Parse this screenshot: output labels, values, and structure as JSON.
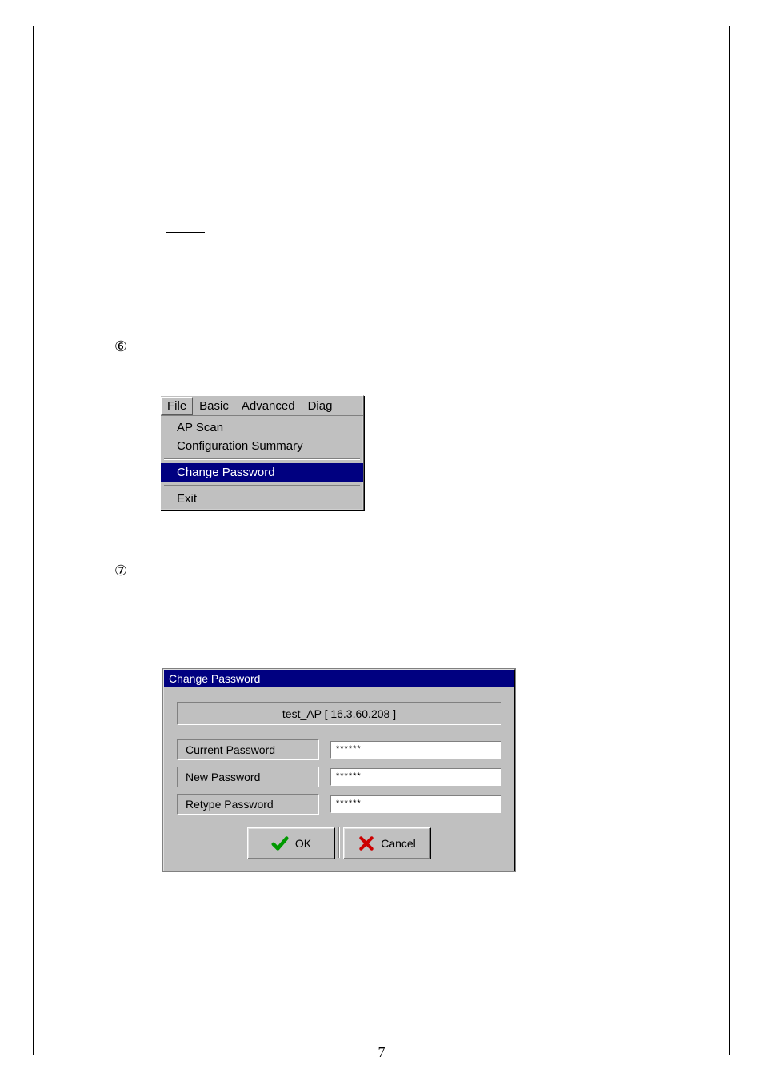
{
  "markers": {
    "six": "⑥",
    "seven": "⑦"
  },
  "menu": {
    "items": [
      "File",
      "Basic",
      "Advanced",
      "Diag"
    ],
    "dropdown": {
      "ap_scan": "AP Scan",
      "config_summary": "Configuration Summary",
      "change_password": "Change Password",
      "exit": "Exit"
    }
  },
  "dialog": {
    "title": "Change Password",
    "host": "test_AP [ 16.3.60.208 ]",
    "labels": {
      "current": "Current Password",
      "new": "New Password",
      "retype": "Retype Password"
    },
    "values": {
      "current": "******",
      "new": "******",
      "retype": "******"
    },
    "buttons": {
      "ok": "OK",
      "cancel": "Cancel"
    }
  },
  "page_number": "7"
}
